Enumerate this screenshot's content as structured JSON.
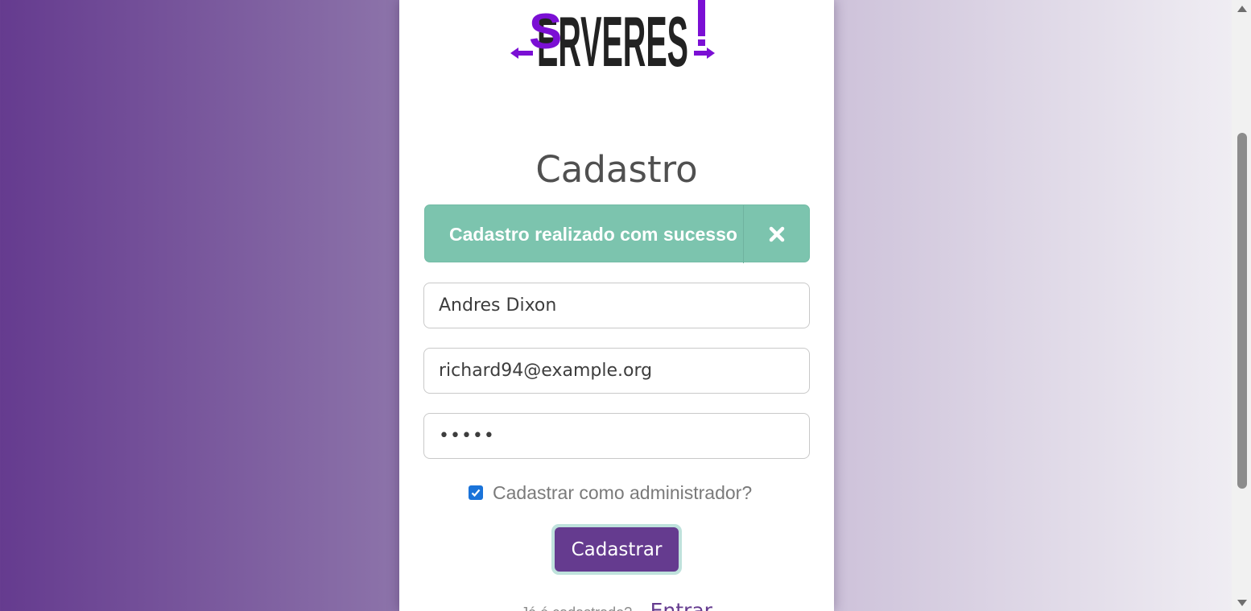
{
  "logo": {
    "text": "SERVEREST",
    "accent_color": "#7b0fd4",
    "dark_color": "#222222"
  },
  "title": "Cadastro",
  "alert": {
    "message": "Cadastro realizado com sucesso",
    "close_icon": "close-x-icon",
    "color": "#7cc4ae"
  },
  "form": {
    "name_value": "Andres Dixon",
    "email_value": "richard94@example.org",
    "password_value": "•••••",
    "admin_label": "Cadastrar como administrador?",
    "admin_checked": true,
    "submit_label": "Cadastrar"
  },
  "footer": {
    "question": "Já é cadastrado?",
    "link_label": "Entrar"
  },
  "colors": {
    "brand": "#653b8f",
    "checkbox": "#1a73d9"
  }
}
